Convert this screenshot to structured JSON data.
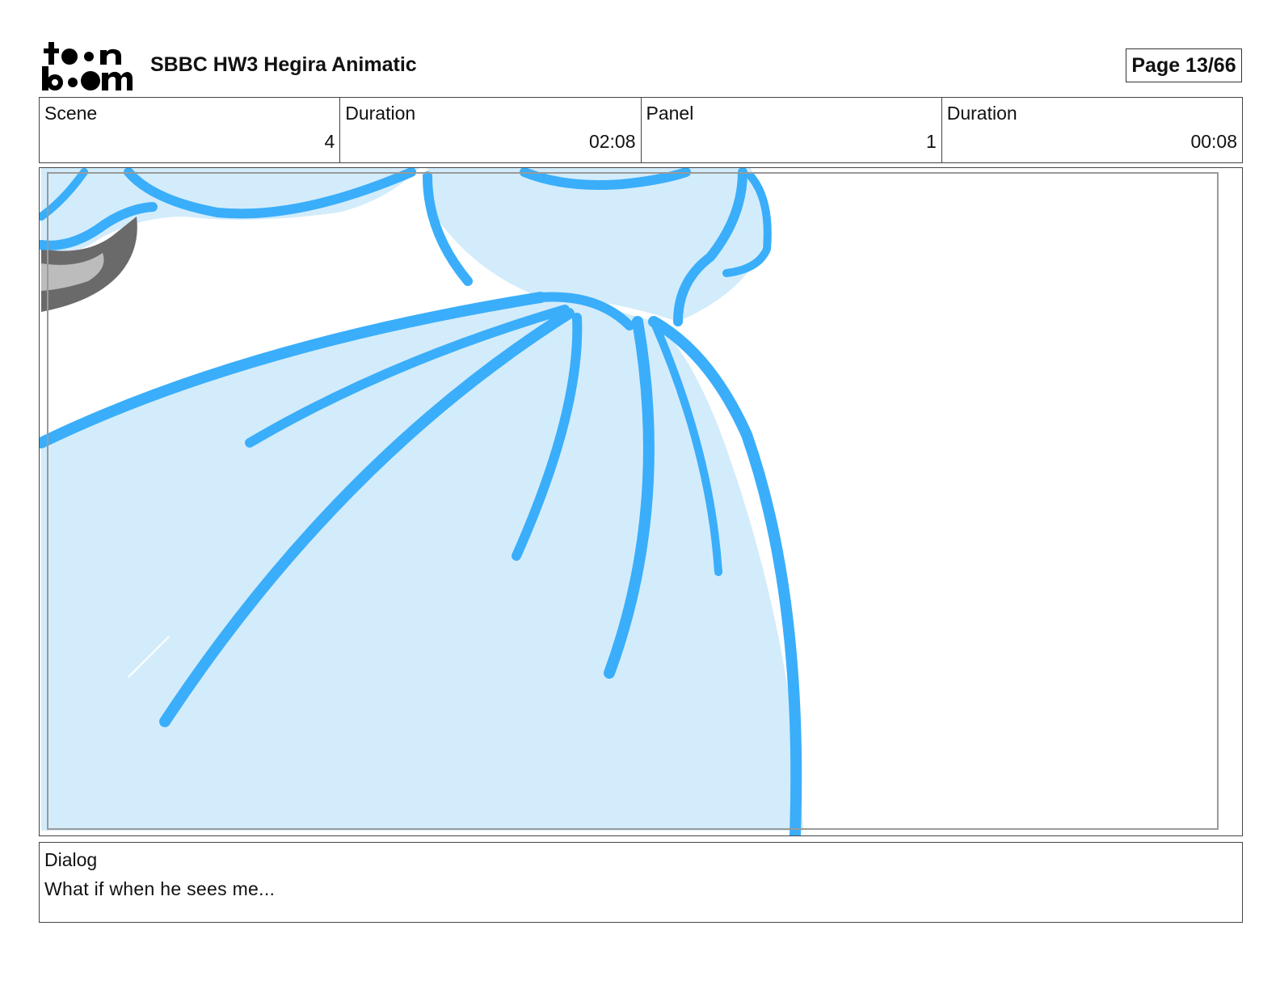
{
  "header": {
    "logo_icon": "toon-boom-logo",
    "title": "SBBC HW3 Hegira Animatic",
    "page_label": "Page 13/66"
  },
  "info": {
    "scene_label": "Scene",
    "scene_value": "4",
    "scene_duration_label": "Duration",
    "scene_duration_value": "02:08",
    "panel_label": "Panel",
    "panel_value": "1",
    "panel_duration_label": "Duration",
    "panel_duration_value": "00:08"
  },
  "panel_image": {
    "subject_icon": "dress-sketch",
    "colors": {
      "line": "#3aaefa",
      "fill": "#d3ecfb",
      "shadow": "#6a6a6a",
      "shadow_light": "#bcbcbc"
    }
  },
  "dialog": {
    "label": "Dialog",
    "text": "What if when he sees me..."
  }
}
